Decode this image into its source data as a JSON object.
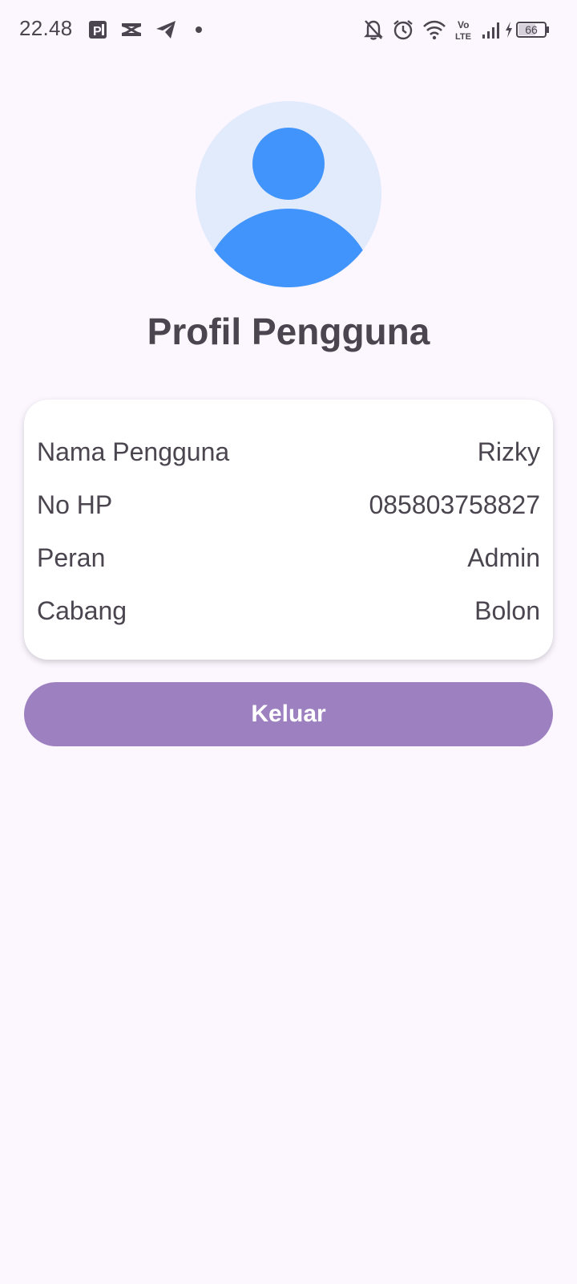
{
  "status_bar": {
    "time": "22.48",
    "battery_level": "66",
    "network": "LTE",
    "icons": [
      "parking-app-icon",
      "capcut-icon",
      "telegram-icon",
      "dot-icon",
      "bell-off-icon",
      "alarm-icon",
      "wifi-icon",
      "volte-icon",
      "signal-icon",
      "charging-icon",
      "battery-icon"
    ]
  },
  "profile": {
    "title": "Profil Pengguna",
    "avatar_icon": "user-avatar-icon"
  },
  "info": {
    "rows": [
      {
        "label": "Nama Pengguna",
        "value": "Rizky"
      },
      {
        "label": "No HP",
        "value": "085803758827"
      },
      {
        "label": "Peran",
        "value": "Admin"
      },
      {
        "label": "Cabang",
        "value": "Bolon"
      }
    ]
  },
  "actions": {
    "logout_label": "Keluar"
  },
  "colors": {
    "background": "#fcf6ff",
    "avatar_bg": "#e1ebfc",
    "avatar_fg": "#4294fd",
    "button": "#9c80c0",
    "text": "#4a454e"
  }
}
